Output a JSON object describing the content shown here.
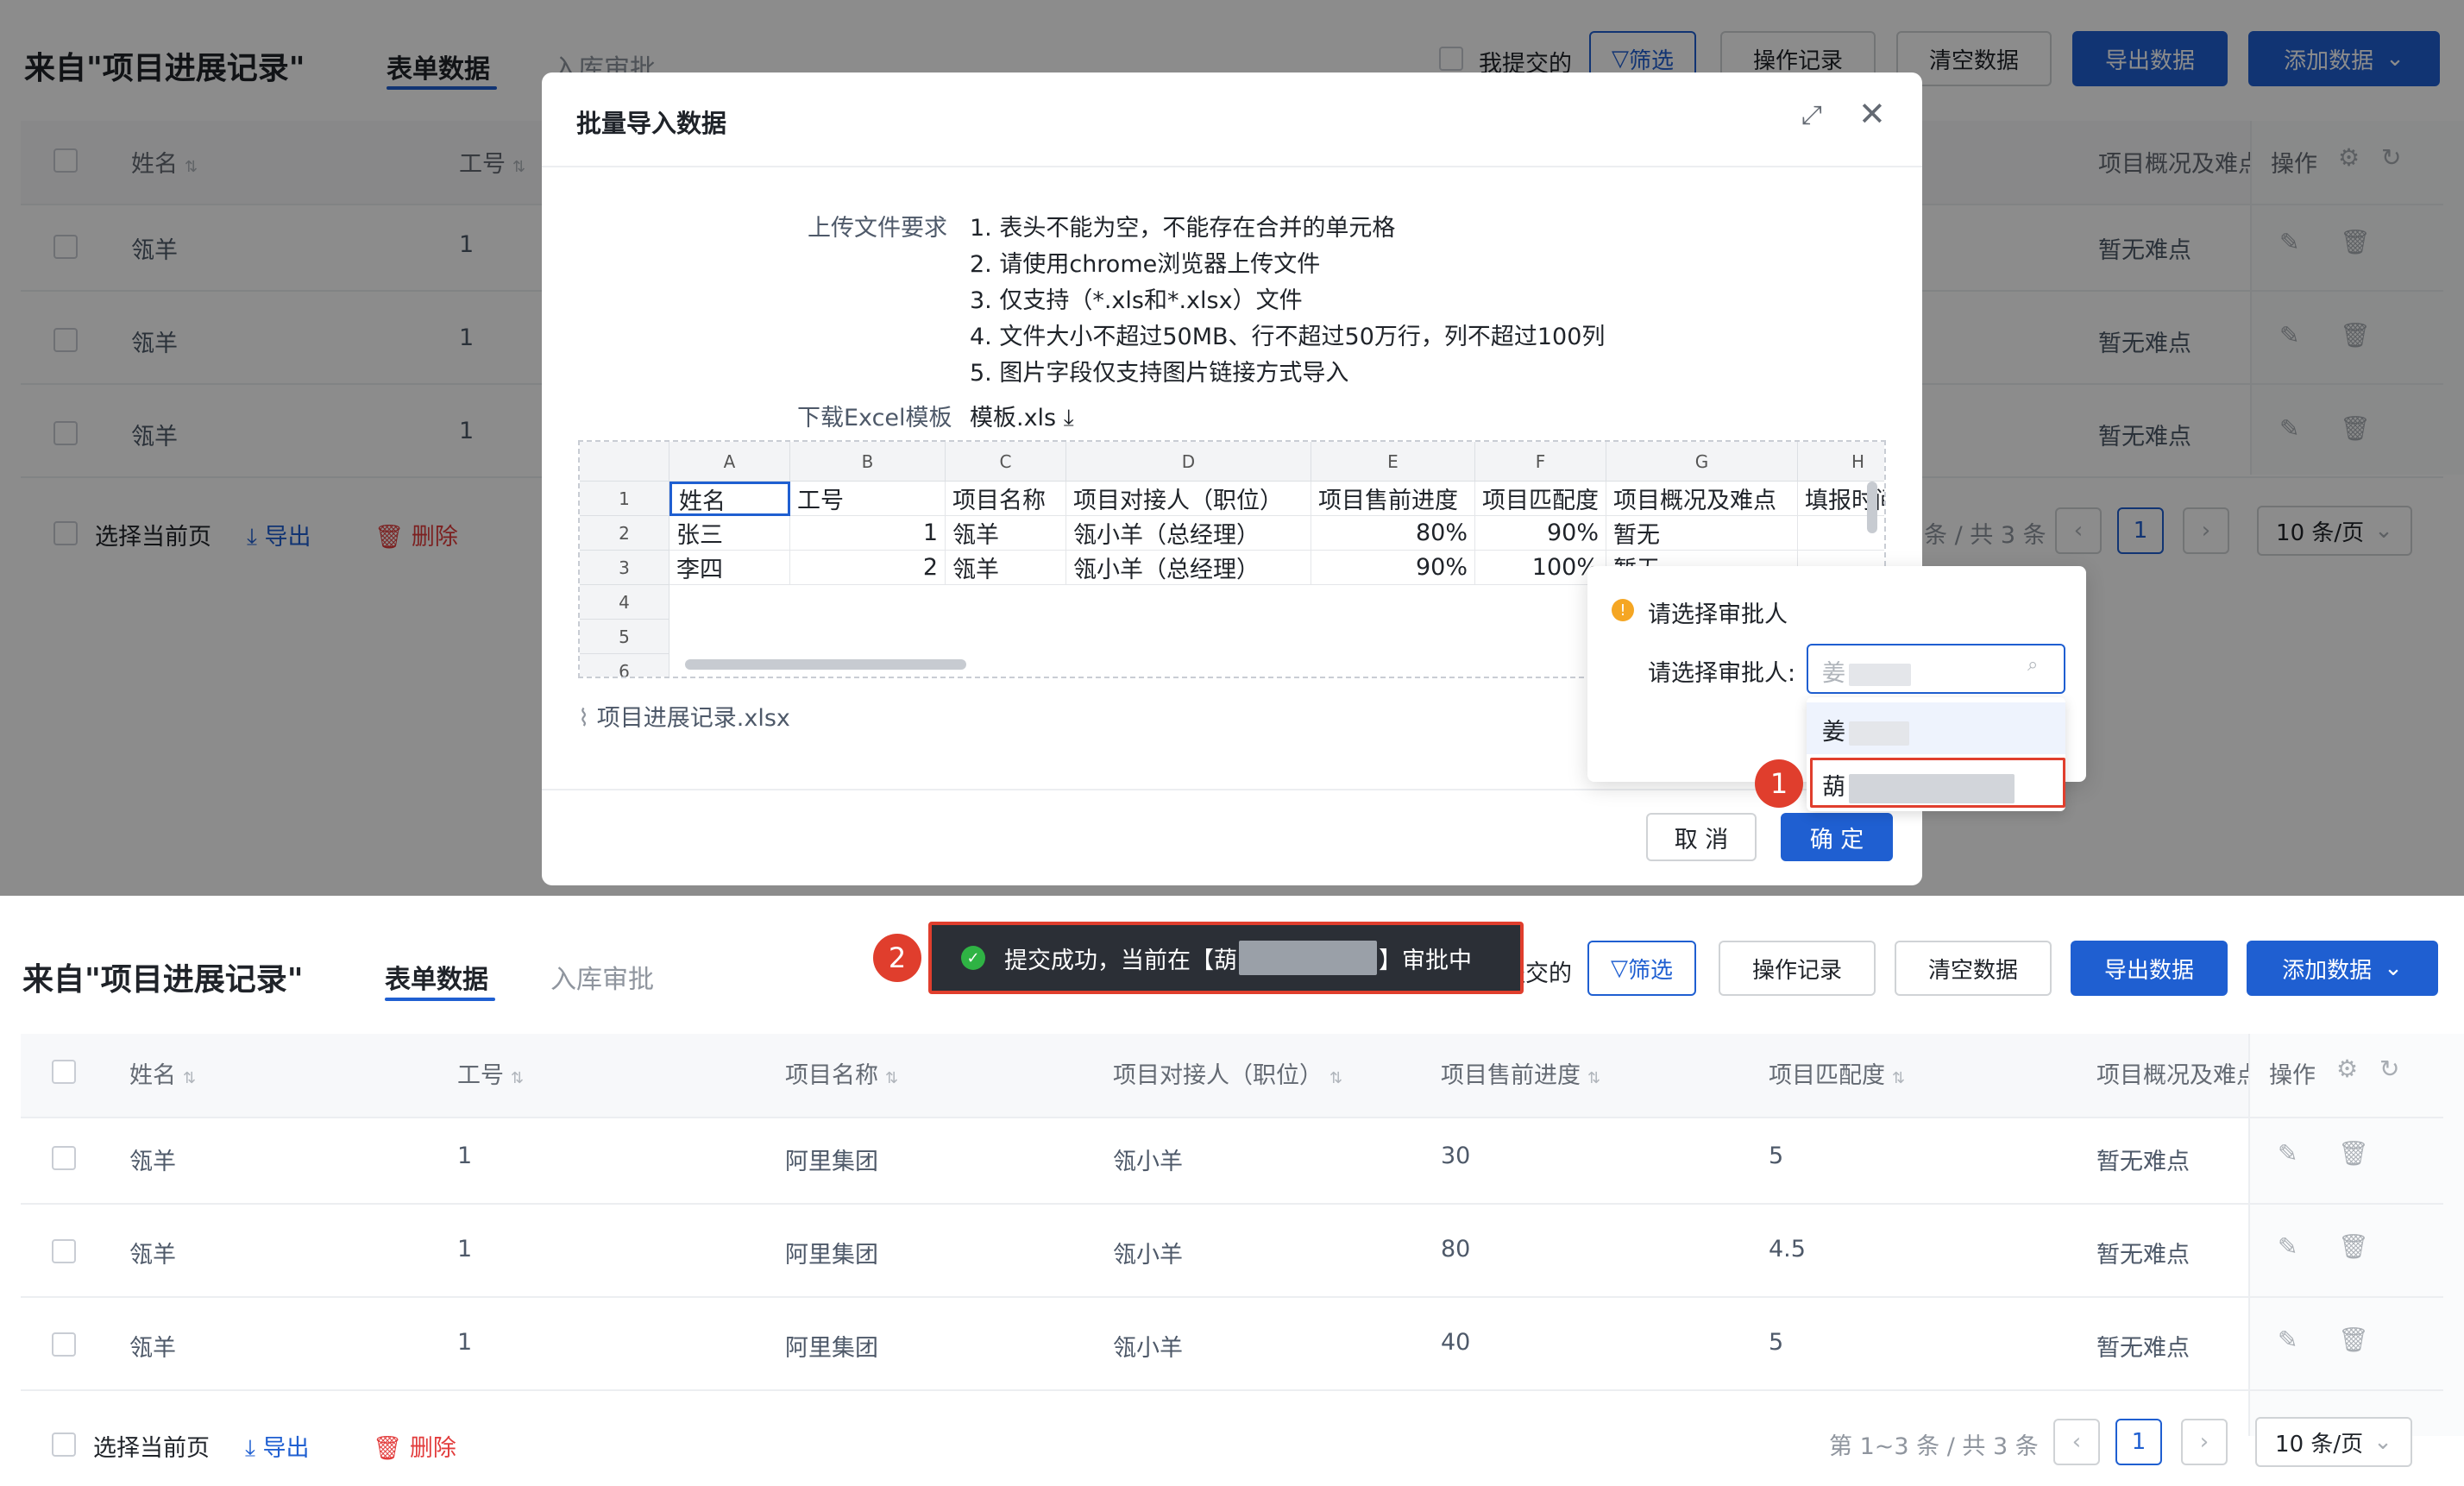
{
  "page": {
    "title": "来自\"项目进展记录\"",
    "tabs": [
      {
        "label": "表单数据"
      },
      {
        "label": "入库审批"
      }
    ],
    "toolbar": {
      "my_submitted": "我提交的",
      "filter": "筛选",
      "operation_log": "操作记录",
      "clear_data": "清空数据",
      "export_data": "导出数据",
      "add_data": "添加数据"
    },
    "table": {
      "headers": [
        "姓名",
        "工号",
        "项目名称",
        "项目对接人（职位）",
        "项目售前进度",
        "项目匹配度",
        "项目概况及难点",
        "操作"
      ],
      "rows": [
        [
          "瓴羊",
          "1",
          "阿里集团",
          "瓴小羊",
          "30",
          "5",
          "暂无难点"
        ],
        [
          "瓴羊",
          "1",
          "阿里集团",
          "瓴小羊",
          "80",
          "4.5",
          "暂无难点"
        ],
        [
          "瓴羊",
          "1",
          "阿里集团",
          "瓴小羊",
          "40",
          "5",
          "暂无难点"
        ]
      ]
    },
    "footer": {
      "select_page": "选择当前页",
      "export": "导出",
      "delete": "删除",
      "range_text": "第 1~3 条 / 共 3 条",
      "range_text_partial": "条 / 共 3 条",
      "current_page": "1",
      "page_size": "10 条/页"
    }
  },
  "modal": {
    "title": "批量导入数据",
    "requirements_label": "上传文件要求",
    "requirements": [
      "1. 表头不能为空，不能存在合并的单元格",
      "2. 请使用chrome浏览器上传文件",
      "3. 仅支持（*.xls和*.xlsx）文件",
      "4. 文件大小不超过50MB、行不超过50万行，列不超过100列",
      "5. 图片字段仅支持图片链接方式导入"
    ],
    "template_label": "下载Excel模板",
    "template_link": "模板.xls",
    "sheet": {
      "columns": [
        "A",
        "B",
        "C",
        "D",
        "E",
        "F",
        "G",
        "H"
      ],
      "row_numbers": [
        "1",
        "2",
        "3",
        "4",
        "5",
        "6"
      ],
      "rows": [
        [
          "姓名",
          "工号",
          "项目名称",
          "项目对接人（职位）",
          "项目售前进度",
          "项目匹配度",
          "项目概况及难点",
          "填报时间"
        ],
        [
          "张三",
          "1",
          "瓴羊",
          "瓴小羊（总经理）",
          "80%",
          "90%",
          "暂无",
          ""
        ],
        [
          "李四",
          "2",
          "瓴羊",
          "瓴小羊（总经理）",
          "90%",
          "100%",
          "暂无",
          ""
        ]
      ]
    },
    "attached_file": "项目进展记录.xlsx",
    "cancel": "取 消",
    "confirm": "确 定"
  },
  "approver_popover": {
    "title": "请选择审批人",
    "field_label": "请选择审批人:",
    "input_value": "姜",
    "options": [
      "姜",
      "葫"
    ]
  },
  "toast": {
    "text_before": "提交成功，当前在【葫",
    "text_after": "】审批中"
  },
  "badges": [
    "1",
    "2"
  ],
  "colors": {
    "primary": "#1f5fd1",
    "danger": "#e23c3c",
    "highlight": "#e03e2d",
    "success": "#2fb344"
  }
}
